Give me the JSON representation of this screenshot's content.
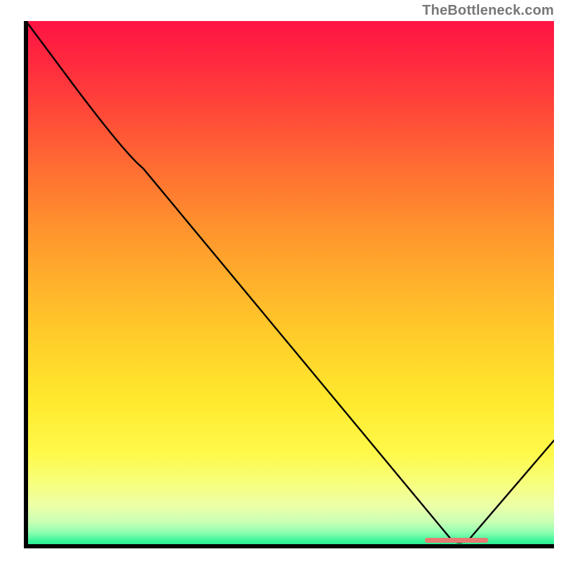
{
  "watermark": "TheBottleneck.com",
  "chart_data": {
    "type": "line",
    "title": "",
    "xlabel": "",
    "ylabel": "",
    "xlim": [
      0,
      100
    ],
    "ylim": [
      0,
      100
    ],
    "grid": false,
    "axes_visible": false,
    "description": "Black curve over a vertical red-to-green heat gradient; curve descends from upper-left, inflects near x≈20, continues down to a minimum near x≈82 (bottom / green zone), then rises to the right edge. A short salmon horizontal marker sits at the minimum.",
    "series": [
      {
        "name": "curve",
        "x": [
          0,
          20,
          82,
          100
        ],
        "values": [
          100,
          75,
          0,
          20
        ]
      }
    ],
    "annotations": [
      {
        "name": "optimal-marker",
        "type": "hbar",
        "x_range": [
          76,
          88
        ],
        "y": 0.8,
        "color": "#e77a72"
      }
    ],
    "background_gradient": {
      "orientation": "vertical",
      "stops": [
        {
          "pos": 0.0,
          "color": "#ff1444"
        },
        {
          "pos": 0.5,
          "color": "#ffb22b"
        },
        {
          "pos": 0.82,
          "color": "#fff94a"
        },
        {
          "pos": 1.0,
          "color": "#14e58e"
        }
      ]
    }
  }
}
